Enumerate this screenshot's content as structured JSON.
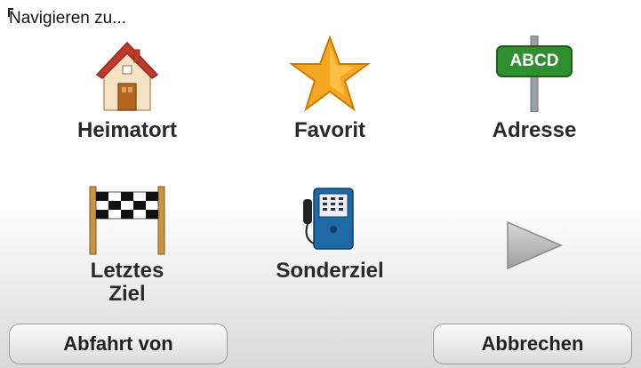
{
  "header": {
    "title": "Navigieren zu..."
  },
  "menu": {
    "items": [
      {
        "label": "Heimatort",
        "icon": "home-icon"
      },
      {
        "label": "Favorit",
        "icon": "star-icon"
      },
      {
        "label": "Adresse",
        "icon": "street-sign-icon",
        "sign_text": "ABCD"
      },
      {
        "label": "Letztes\nZiel",
        "icon": "checkered-flag-icon"
      },
      {
        "label": "Sonderziel",
        "icon": "payphone-icon"
      }
    ],
    "next_icon": "next-arrow-icon"
  },
  "footer": {
    "left_button": "Abfahrt von",
    "right_button": "Abbrechen"
  },
  "colors": {
    "roof": "#c0392b",
    "star": "#f5a623",
    "sign_green": "#2f8f2f",
    "phone_blue": "#1d6aa6"
  }
}
